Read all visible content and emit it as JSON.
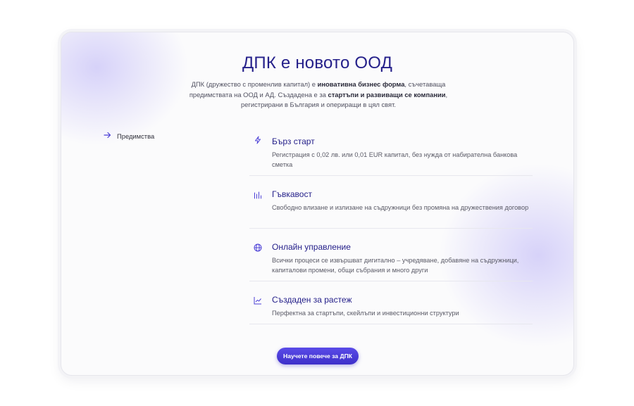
{
  "hero": {
    "title": "ДПК е новото ООД",
    "intro": {
      "part1": "ДПК (дружество с променлив капитал) е ",
      "bold1": "иновативна бизнес форма",
      "part2": ", съчетаваща предимствата на ООД и АД. Създадена е за ",
      "bold2": "стартъпи и развиващи се компании",
      "part3": ", регистрирани в България и опериращи в цял свят."
    }
  },
  "side_nav": {
    "item_label": "Предимства",
    "item_icon": "arrow-right-icon"
  },
  "features": [
    {
      "title": "Бърз старт",
      "description": "Регистрация с 0,02 лв. или 0,01 EUR капитал, без нужда от набирателна банкова сметка",
      "icon": "lightning-icon"
    },
    {
      "title": "Гъвкавост",
      "description": "Свободно влизане и излизане на съдружници без промяна на дружествения договор",
      "icon": "bar-chart-icon"
    },
    {
      "title": "Онлайн управление",
      "description": "Всички процеси се извършват дигитално – учредяване, добавяне на съдружници, капиталови промени, общи събрания и много други",
      "icon": "globe-icon"
    },
    {
      "title": "Създаден за растеж",
      "description": "Перфектна за стартъпи, скейлъпи и инвестиционни структури",
      "icon": "trend-up-icon"
    }
  ],
  "cta": {
    "label": "Научете повече за ДПК"
  },
  "colors": {
    "accent": "#3d2fc9",
    "heading": "#25208a"
  }
}
